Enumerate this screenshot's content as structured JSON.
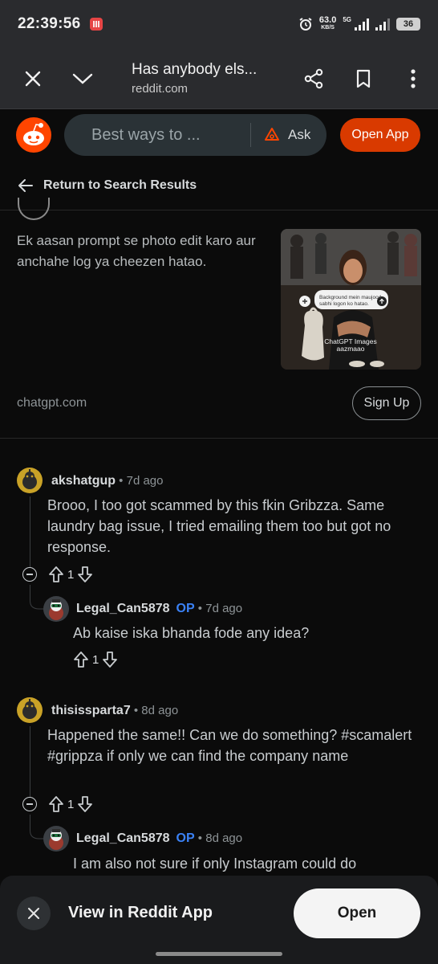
{
  "status_bar": {
    "time": "22:39:56",
    "speed_value": "63.0",
    "speed_unit": "KB/S",
    "network": "5G",
    "battery": "36"
  },
  "browser": {
    "tab_title": "Has anybody els...",
    "url": "reddit.com"
  },
  "reddit_header": {
    "search_placeholder": "Best ways to ...",
    "ask_label": "Ask",
    "open_app_label": "Open App"
  },
  "nav": {
    "return_label": "Return to Search Results"
  },
  "ad": {
    "text": "Ek aasan prompt se photo edit karo aur anchahe log ya cheezen hatao.",
    "image_prompt": "Background mein maujood sabhi logon ko hatao.",
    "image_caption_line1": "ChatGPT Images",
    "image_caption_line2": "aazmaao",
    "domain": "chatgpt.com",
    "signup_label": "Sign Up"
  },
  "comments": [
    {
      "author": "akshatgup",
      "time": " • 7d ago",
      "body": "Brooo, I too got scammed by this fkin Gribzza. Same laundry bag issue, I tried emailing them too but got no response.",
      "votes": "1",
      "reply": {
        "author": "Legal_Can5878",
        "op": "OP",
        "time": " • 7d ago",
        "body": "Ab kaise iska bhanda fode any idea?",
        "votes": "1"
      }
    },
    {
      "author": "thisissparta7",
      "time": " • 8d ago",
      "body": "Happened the same!! Can we do something? #scamalert #grippza if only we can find the company name",
      "votes": "1",
      "reply": {
        "author": "Legal_Can5878",
        "op": "OP",
        "time": " • 8d ago",
        "body": "I am also not sure if only Instagram could do"
      }
    }
  ],
  "bottom_sheet": {
    "label": "View in Reddit App",
    "open_label": "Open"
  },
  "colors": {
    "accent_orange": "#d93a00",
    "op_blue": "#3b82f6",
    "background": "#0b0b0b"
  }
}
